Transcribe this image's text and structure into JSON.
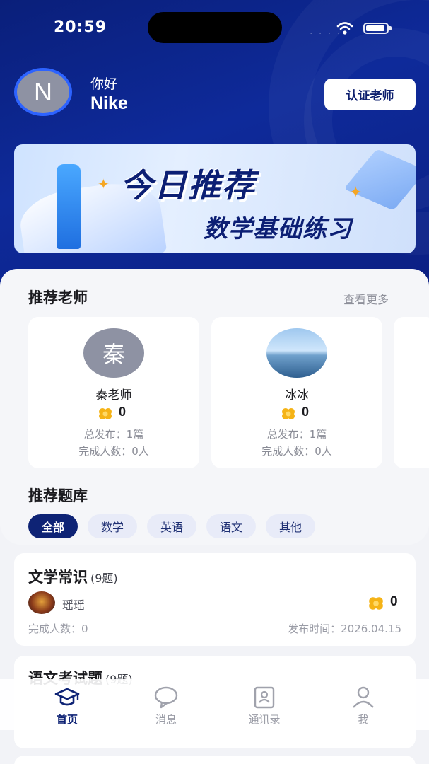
{
  "status_bar": {
    "time": "20:59",
    "dots": "· · · ·"
  },
  "profile": {
    "avatar_letter": "N",
    "greeting": "你好",
    "name": "Nike",
    "certify_label": "认证老师"
  },
  "banner": {
    "title": "今日推荐",
    "subtitle": "数学基础练习"
  },
  "teachers_section": {
    "title": "推荐老师",
    "more_label": "查看更多",
    "teachers": [
      {
        "avatar_text": "秦",
        "name": "秦老师",
        "score": "0",
        "published": "总发布：1篇",
        "completed": "完成人数：0人"
      },
      {
        "avatar_text": "",
        "name": "冰冰",
        "score": "0",
        "published": "总发布：1篇",
        "completed": "完成人数：0人"
      }
    ]
  },
  "bank_section": {
    "title": "推荐题库",
    "filters": [
      "全部",
      "数学",
      "英语",
      "语文",
      "其他"
    ],
    "active_filter": "全部"
  },
  "question_sets": [
    {
      "title": "文学常识",
      "count": "(9题)",
      "author": "瑶瑶",
      "score": "0",
      "completed": "完成人数：0",
      "published_at": "发布时间：2026.04.15"
    },
    {
      "title": "语文考试题",
      "count": "(9题)"
    }
  ],
  "tabbar": {
    "items": [
      {
        "label": "首页",
        "icon": "graduation-cap-icon"
      },
      {
        "label": "消息",
        "icon": "chat-bubble-icon"
      },
      {
        "label": "通讯录",
        "icon": "contacts-book-icon"
      },
      {
        "label": "我",
        "icon": "person-icon"
      }
    ],
    "active": "首页"
  },
  "colors": {
    "primary": "#0e2375",
    "header_bg": "#0e2a9a",
    "coin": "#f5b316",
    "chip_bg": "#e8ebf8"
  }
}
